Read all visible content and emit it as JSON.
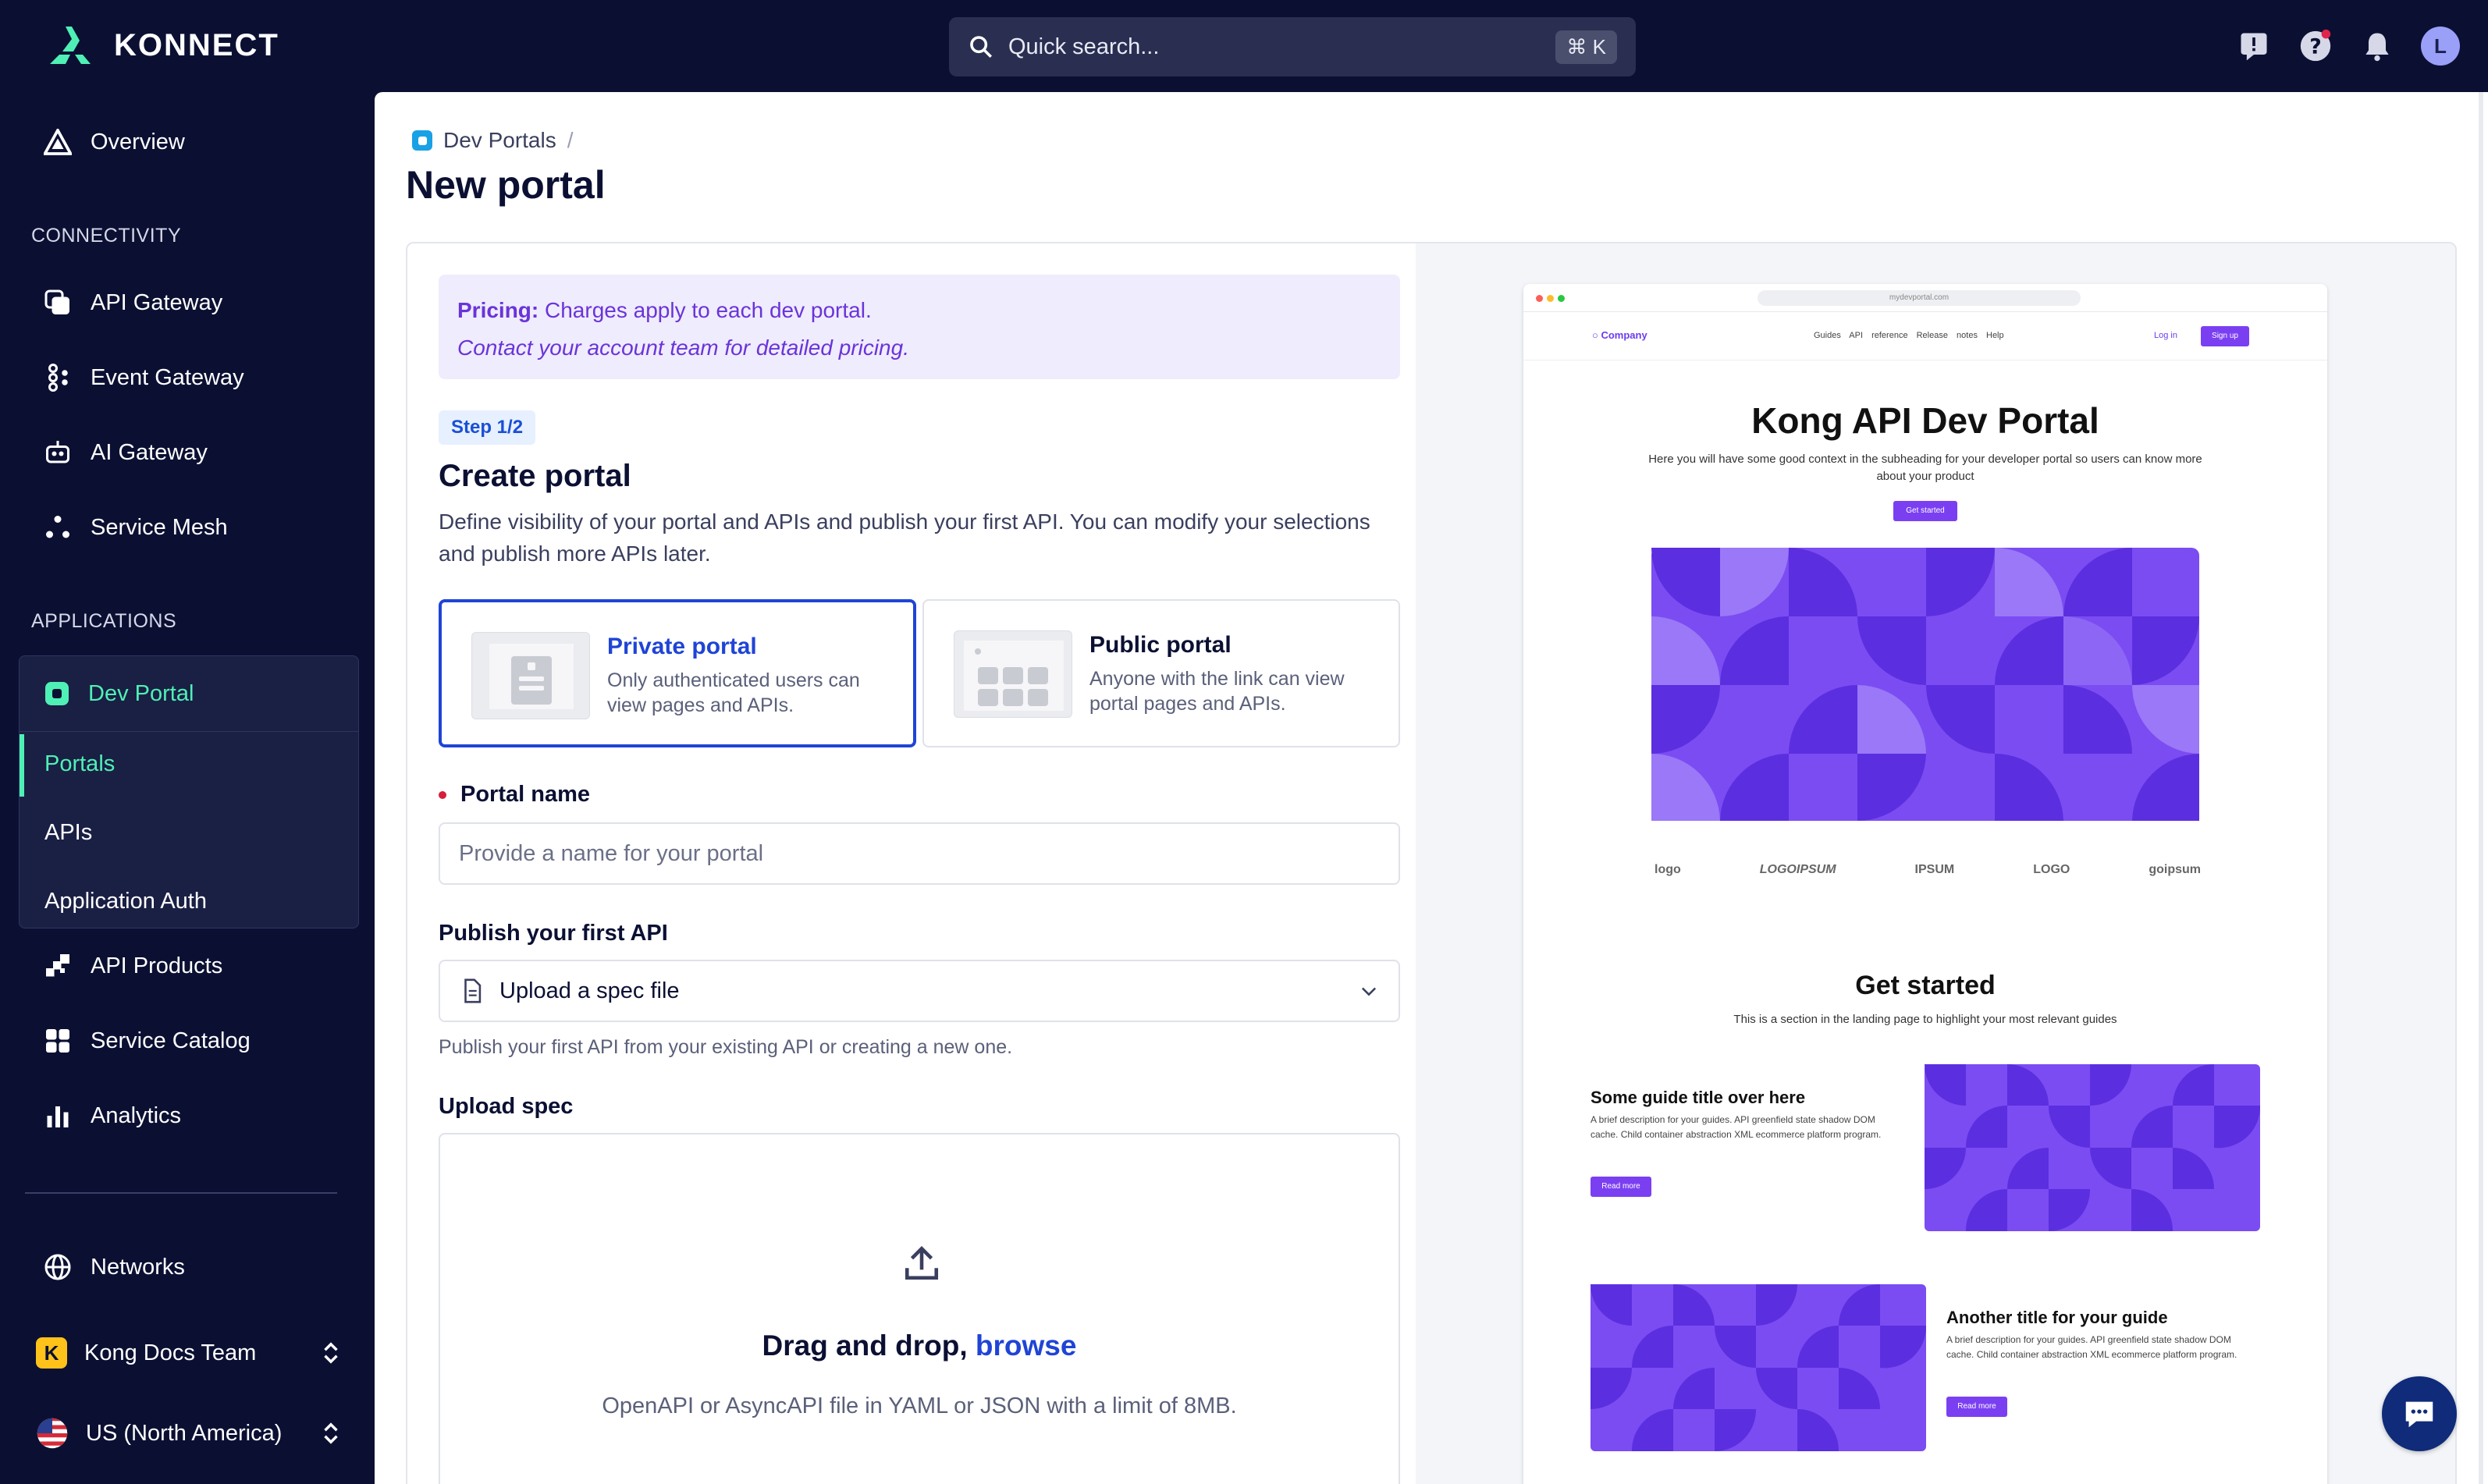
{
  "app": {
    "name": "KONNECT"
  },
  "search": {
    "placeholder": "Quick search...",
    "shortcut": "⌘ K"
  },
  "user": {
    "initial": "L"
  },
  "sidebar": {
    "overview": "Overview",
    "connectivity_label": "CONNECTIVITY",
    "connectivity": [
      "API Gateway",
      "Event Gateway",
      "AI Gateway",
      "Service Mesh"
    ],
    "applications_label": "APPLICATIONS",
    "dev_portal": "Dev Portal",
    "dev_portal_items": [
      "Portals",
      "APIs",
      "Application Auth"
    ],
    "more": [
      "API Products",
      "Service Catalog",
      "Analytics"
    ],
    "networks": "Networks",
    "team": {
      "initial": "K",
      "name": "Kong Docs Team"
    },
    "region": "US (North America)"
  },
  "breadcrumb": {
    "parent": "Dev Portals",
    "separator": "/"
  },
  "page": {
    "title": "New portal"
  },
  "pricing": {
    "label": "Pricing:",
    "text": "Charges apply to each dev portal.",
    "contact": "Contact your account team for detailed pricing."
  },
  "step": {
    "label": "Step 1/2"
  },
  "create": {
    "title": "Create portal",
    "description": "Define visibility of your portal and APIs and publish your first API. You can modify your selections and publish more APIs later."
  },
  "options": [
    {
      "title": "Private portal",
      "desc": "Only authenticated users can view pages and APIs."
    },
    {
      "title": "Public portal",
      "desc": "Anyone with the link can view portal pages and APIs."
    }
  ],
  "portal_name": {
    "label": "Portal name",
    "placeholder": "Provide a name for your portal"
  },
  "publish": {
    "label": "Publish your first API",
    "selected": "Upload a spec file",
    "help": "Publish your first API from your existing API or creating a new one."
  },
  "upload": {
    "label": "Upload spec",
    "title": "Drag and drop,",
    "link": "browse",
    "sub": "OpenAPI or AsyncAPI file in YAML or JSON with a limit of 8MB."
  },
  "preview": {
    "url": "mydevportal.com",
    "brand": "Company",
    "nav_links": "Guides API reference Release notes Help",
    "login": "Log in",
    "signup": "Sign up",
    "hero_title": "Kong API Dev Portal",
    "hero_sub": "Here you will have some good context in the subheading for your developer portal so users can know more about your product",
    "hero_btn": "Get started",
    "logos": [
      "logo",
      "LOGOIPSUM",
      "IPSUM",
      "LOGO",
      "goipsum"
    ],
    "section_title": "Get started",
    "section_sub": "This is a section in the landing page to highlight your most relevant guides",
    "guides": [
      {
        "title": "Some guide title over here",
        "desc": "A brief description for your guides. API greenfield state shadow DOM cache. Child container abstraction XML ecommerce platform program.",
        "btn": "Read more"
      },
      {
        "title": "Another title for your guide",
        "desc": "A brief description for your guides. API greenfield state shadow DOM cache. Child container abstraction XML ecommerce platform program.",
        "btn": "Read more"
      }
    ]
  },
  "colors": {
    "nav_bg": "#0b1033",
    "accent_mint": "#4ff0b5",
    "primary_blue": "#1f44d6",
    "purple": "#7b3ff2"
  }
}
